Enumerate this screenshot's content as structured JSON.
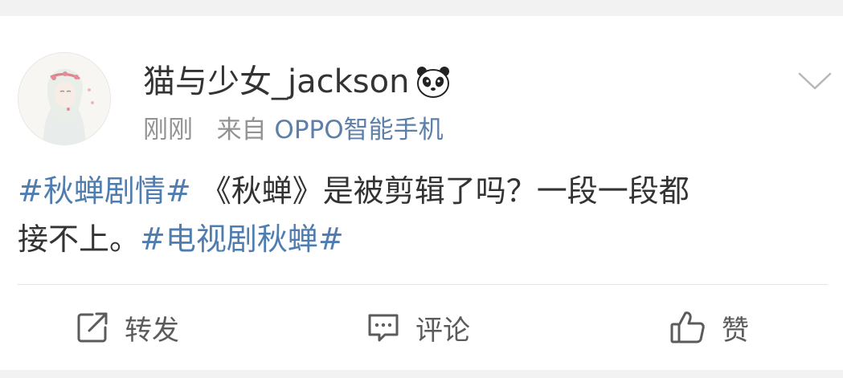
{
  "post": {
    "author": "猫与少女_jackson",
    "timestamp": "刚刚",
    "from_label": "来自",
    "device": "OPPO智能手机",
    "content_line1": [
      {
        "type": "topic",
        "text": "#秋蝉剧情#"
      },
      {
        "type": "text",
        "text": " 《秋蝉》是被剪辑了吗？一段一段都"
      }
    ],
    "content_line2": [
      {
        "type": "text",
        "text": "接不上。"
      },
      {
        "type": "topic",
        "text": "#电视剧秋蝉#"
      }
    ]
  },
  "actions": {
    "repost_label": "转发",
    "comment_label": "评论",
    "like_label": "赞"
  },
  "icons": {
    "avatar": "avatar-image",
    "badge": "panda-icon",
    "menu": "chevron-down-icon",
    "repost": "repost-icon",
    "comment": "comment-icon",
    "like": "thumbs-up-icon"
  },
  "colors": {
    "topic": "#4f7db0",
    "device": "#5d7fa8",
    "meta": "#939393"
  }
}
